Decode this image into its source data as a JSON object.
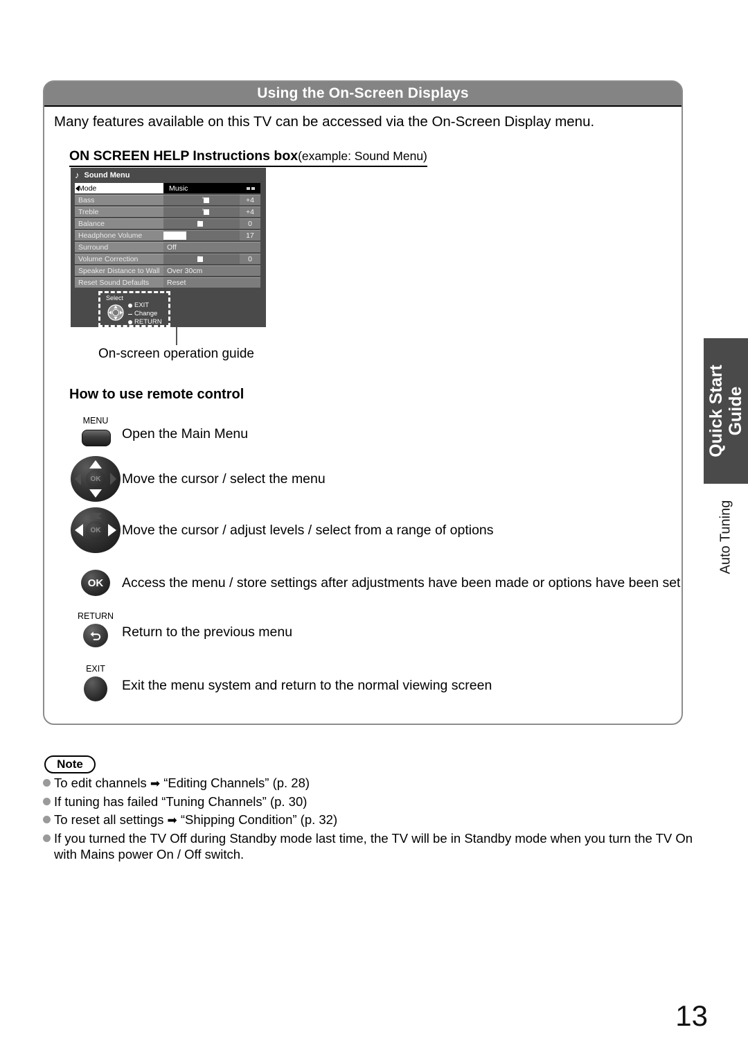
{
  "header": {
    "title": "Using the On-Screen Displays"
  },
  "intro": "Many features available on this TV can be accessed via the On-Screen Display menu.",
  "subhead": {
    "bold": "ON SCREEN HELP Instructions box",
    "light": "(example: Sound Menu)"
  },
  "osd": {
    "title": "Sound Menu",
    "note_icon": "music-note-icon",
    "rows": [
      {
        "label": "Mode",
        "value": "Music",
        "type": "select"
      },
      {
        "label": "Bass",
        "value": "+4",
        "type": "slider",
        "knob_pct": 56,
        "tick_pct": 52
      },
      {
        "label": "Treble",
        "value": "+4",
        "type": "slider",
        "knob_pct": 56,
        "tick_pct": 52
      },
      {
        "label": "Balance",
        "value": "0",
        "type": "slider",
        "knob_pct": 48,
        "tick_pct": 46
      },
      {
        "label": "Headphone Volume",
        "value": "17",
        "type": "bar",
        "fill_pct": 30
      },
      {
        "label": "Surround",
        "value": "Off",
        "type": "text"
      },
      {
        "label": "Volume Correction",
        "value": "0",
        "type": "slider",
        "knob_pct": 48,
        "tick_pct": 46
      },
      {
        "label": "Speaker Distance to Wall",
        "value": "Over 30cm",
        "type": "text"
      },
      {
        "label": "Reset Sound Defaults",
        "value": "Reset",
        "type": "text"
      }
    ],
    "guide": {
      "select": "Select",
      "exit": "EXIT",
      "change": "Change",
      "return": "RETURN"
    }
  },
  "callout_label": "On-screen operation guide",
  "remote": {
    "title": "How to use remote control",
    "rows": [
      {
        "key": "MENU",
        "icon": "menu-button-icon",
        "text": "Open the Main Menu"
      },
      {
        "key": "",
        "icon": "dpad-up-down-icon",
        "text": "Move the cursor / select the menu"
      },
      {
        "key": "",
        "icon": "dpad-left-right-icon",
        "text": "Move the cursor / adjust levels / select from a range of options"
      },
      {
        "key": "OK",
        "icon": "ok-button-icon",
        "text": "Access the menu / store settings after adjustments have been made or options have been set"
      },
      {
        "key": "RETURN",
        "icon": "return-button-icon",
        "text": "Return to the previous menu"
      },
      {
        "key": "EXIT",
        "icon": "exit-button-icon",
        "text": "Exit the menu system and return to the normal viewing screen"
      }
    ],
    "ok_label": "OK"
  },
  "side_tab": {
    "line1": "Quick Start",
    "line2": "Guide",
    "sub": "Auto Tuning"
  },
  "note": {
    "badge": "Note",
    "items": [
      {
        "text": "To edit channels",
        "arrow": "➡",
        "tail": "“Editing Channels” (p. 28)"
      },
      {
        "text": "If tuning has failed “Tuning Channels” (p. 30)",
        "arrow": "",
        "tail": ""
      },
      {
        "text": "To reset all settings",
        "arrow": "➡",
        "tail": "“Shipping Condition” (p. 32)"
      },
      {
        "text": "If you turned the TV Off during Standby mode last time, the TV will be in Standby mode when you turn the TV On with Mains power On / Off switch.",
        "arrow": "",
        "tail": ""
      }
    ]
  },
  "page_number": "13"
}
